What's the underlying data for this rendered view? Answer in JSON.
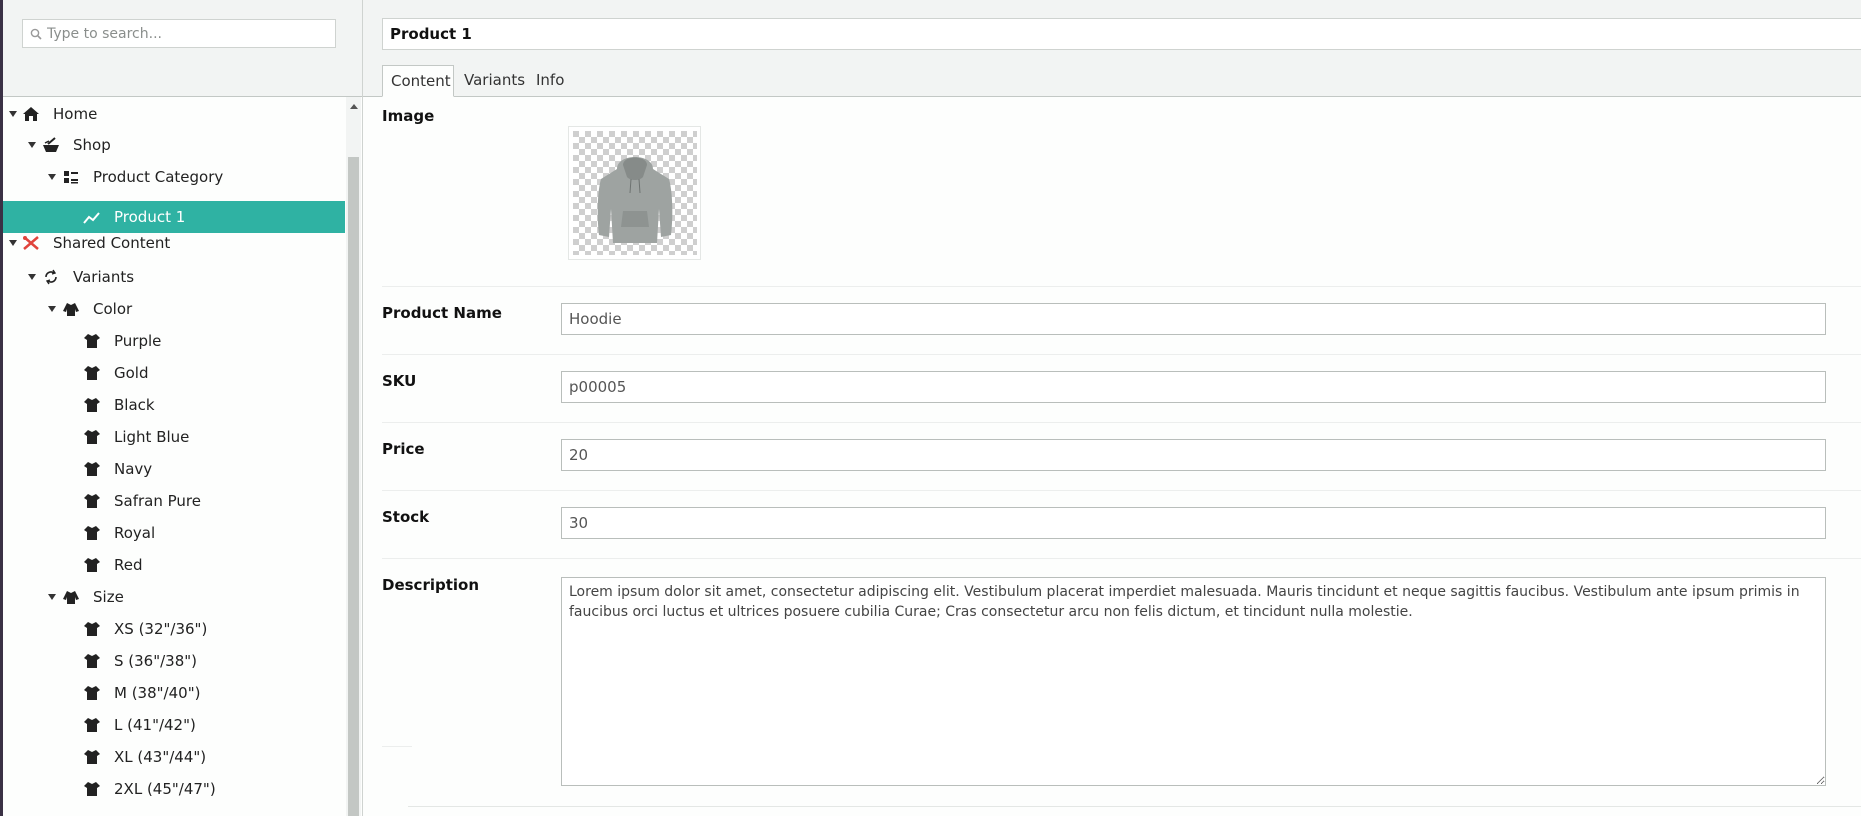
{
  "search": {
    "placeholder": "Type to search..."
  },
  "tree": {
    "nodes": [
      {
        "label": "Home",
        "icon": "home-icon"
      },
      {
        "label": "Shop",
        "icon": "shop-icon"
      },
      {
        "label": "Product Category",
        "icon": "category-list-icon"
      },
      {
        "label": "Product 1",
        "icon": "product-trend-icon",
        "selected": true
      },
      {
        "label": "Shared Content",
        "icon": "shared-tools-icon"
      },
      {
        "label": "Variants",
        "icon": "variants-icon"
      },
      {
        "label": "Color",
        "icon": "variant-group-icon"
      },
      {
        "label": "Purple",
        "icon": "tshirt-icon"
      },
      {
        "label": "Gold",
        "icon": "tshirt-icon"
      },
      {
        "label": "Black",
        "icon": "tshirt-icon"
      },
      {
        "label": "Light Blue",
        "icon": "tshirt-icon"
      },
      {
        "label": "Navy",
        "icon": "tshirt-icon"
      },
      {
        "label": "Safran Pure",
        "icon": "tshirt-icon"
      },
      {
        "label": "Royal",
        "icon": "tshirt-icon"
      },
      {
        "label": "Red",
        "icon": "tshirt-icon"
      },
      {
        "label": "Size",
        "icon": "variant-group-icon"
      },
      {
        "label": "XS (32\"/36\")",
        "icon": "tshirt-icon"
      },
      {
        "label": "S (36\"/38\")",
        "icon": "tshirt-icon"
      },
      {
        "label": "M (38\"/40\")",
        "icon": "tshirt-icon"
      },
      {
        "label": "L (41\"/42\")",
        "icon": "tshirt-icon"
      },
      {
        "label": "XL (43\"/44\")",
        "icon": "tshirt-icon"
      },
      {
        "label": "2XL (45\"/47\")",
        "icon": "tshirt-icon"
      }
    ]
  },
  "editor": {
    "title": "Product 1",
    "tabs": [
      {
        "label": "Content",
        "active": true
      },
      {
        "label": "Variants"
      },
      {
        "label": "Info"
      }
    ],
    "fields": {
      "image": {
        "label": "Image"
      },
      "product_name": {
        "label": "Product Name",
        "value": "Hoodie"
      },
      "sku": {
        "label": "SKU",
        "value": "p00005"
      },
      "price": {
        "label": "Price",
        "value": "20"
      },
      "stock": {
        "label": "Stock",
        "value": "30"
      },
      "description": {
        "label": "Description",
        "value": "Lorem ipsum dolor sit amet, consectetur adipiscing elit. Vestibulum placerat imperdiet malesuada. Mauris tincidunt et neque sagittis faucibus. Vestibulum ante ipsum primis in faucibus orci luctus et ultrices posuere cubilia Curae; Cras consectetur arcu non felis dictum, et tincidunt nulla molestie."
      }
    }
  },
  "colors": {
    "accent": "#2fb2a3",
    "header_bg": "#f2f4f3",
    "border": "#c3c8c5"
  }
}
